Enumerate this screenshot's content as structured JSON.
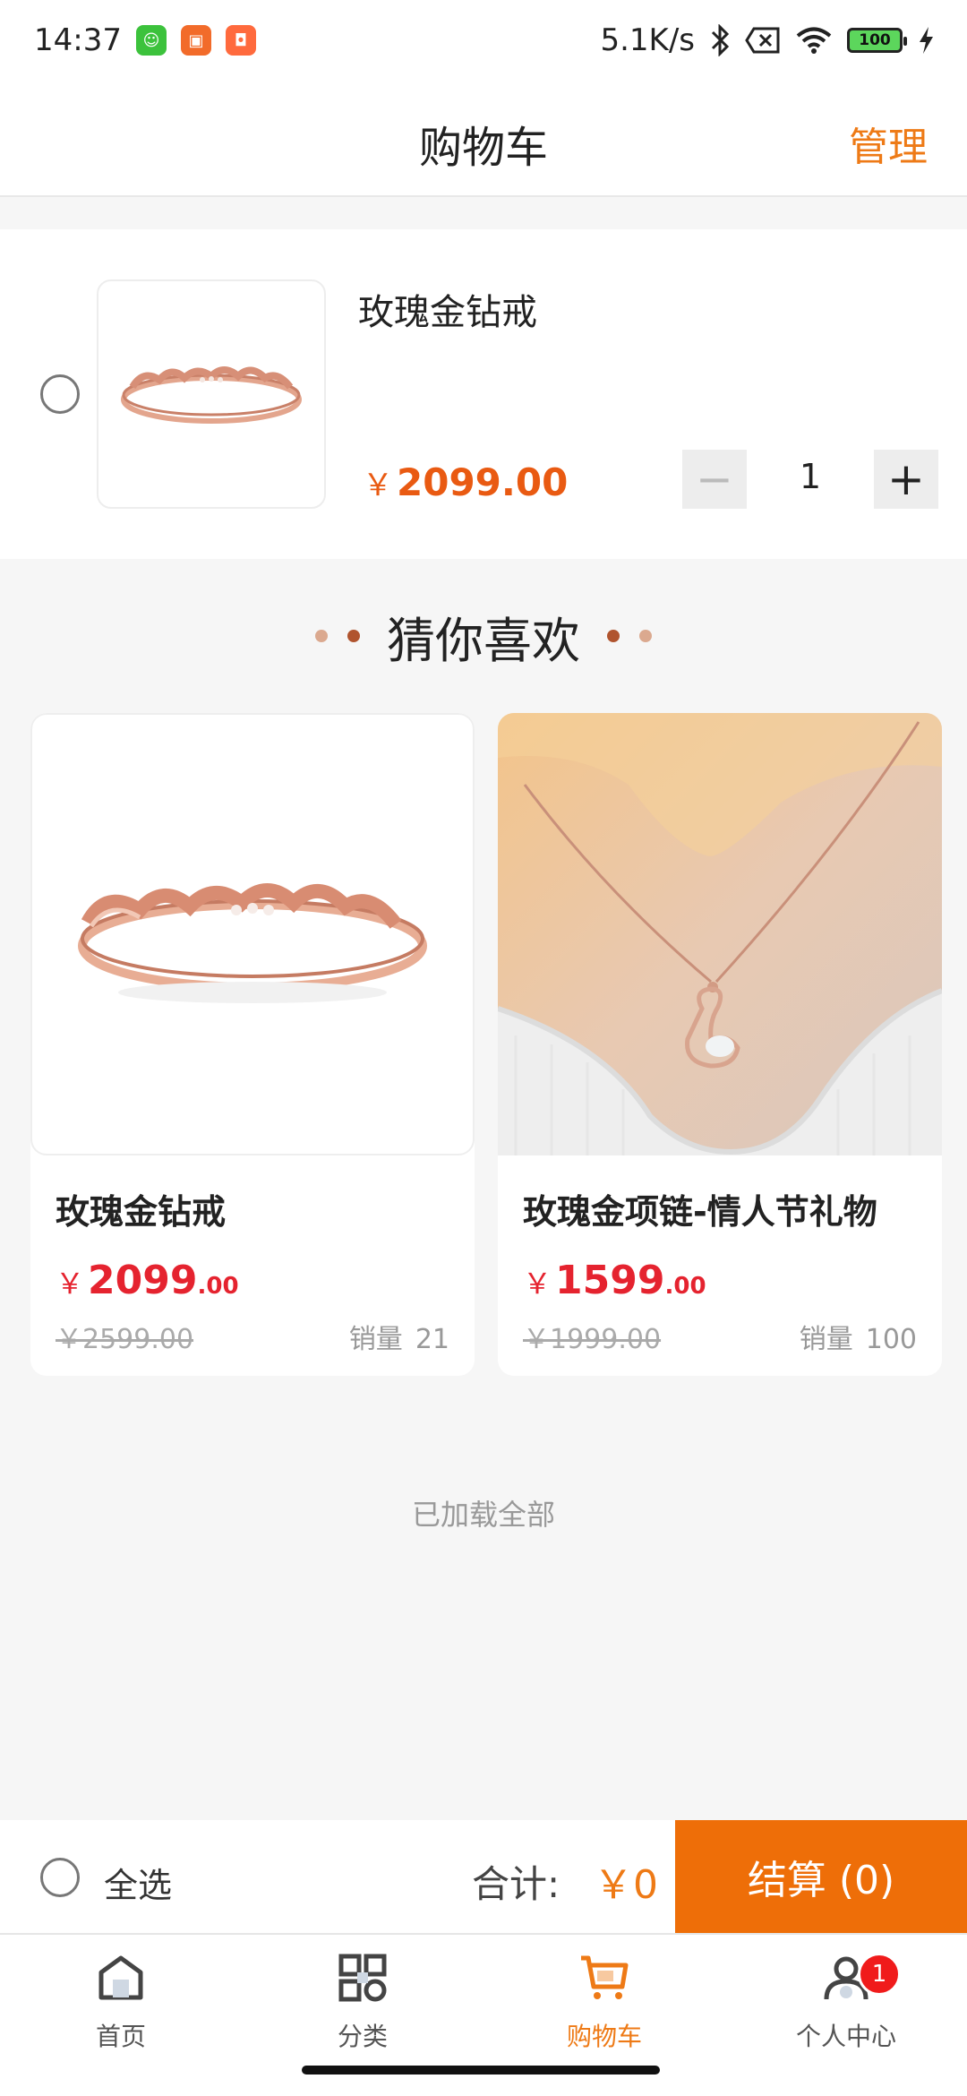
{
  "status_bar": {
    "time": "14:37",
    "network_speed": "5.1K/s",
    "battery": "100",
    "icons": [
      "app-green-icon",
      "app-orange-icon",
      "app-orange2-icon",
      "bluetooth-icon",
      "sim-x-icon",
      "wifi-icon",
      "battery-icon",
      "charging-icon"
    ]
  },
  "header": {
    "title": "购物车",
    "manage_label": "管理"
  },
  "cart": {
    "items": [
      {
        "name": "玫瑰金钻戒",
        "price_symbol": "￥",
        "price": "2099.00",
        "quantity": "1",
        "minus": "−",
        "plus": "+"
      }
    ]
  },
  "recommend": {
    "title": "猜你喜欢",
    "items": [
      {
        "name": "玫瑰金钻戒",
        "price_symbol": "￥",
        "price_int": "2099",
        "price_dec": ".00",
        "original_price": "￥2599.00",
        "sales_label": "销量",
        "sales": "21"
      },
      {
        "name": "玫瑰金项链-情人节礼物",
        "price_symbol": "￥",
        "price_int": "1599",
        "price_dec": ".00",
        "original_price": "￥1999.00",
        "sales_label": "销量",
        "sales": "100"
      }
    ]
  },
  "loaded_text": "已加载全部",
  "checkout": {
    "select_all_label": "全选",
    "total_label": "合计:",
    "total_value": "￥0",
    "checkout_button": "结算 (0)"
  },
  "tabs": [
    {
      "label": "首页",
      "icon": "home-icon"
    },
    {
      "label": "分类",
      "icon": "category-icon"
    },
    {
      "label": "购物车",
      "icon": "cart-icon",
      "active": true
    },
    {
      "label": "个人中心",
      "icon": "user-icon",
      "badge": "1"
    }
  ],
  "colors": {
    "accent": "#ee7a16",
    "checkout_button": "#ee6e08",
    "price_red": "#e5232f",
    "cart_price": "#e95a12",
    "badge": "#f01b1b"
  }
}
